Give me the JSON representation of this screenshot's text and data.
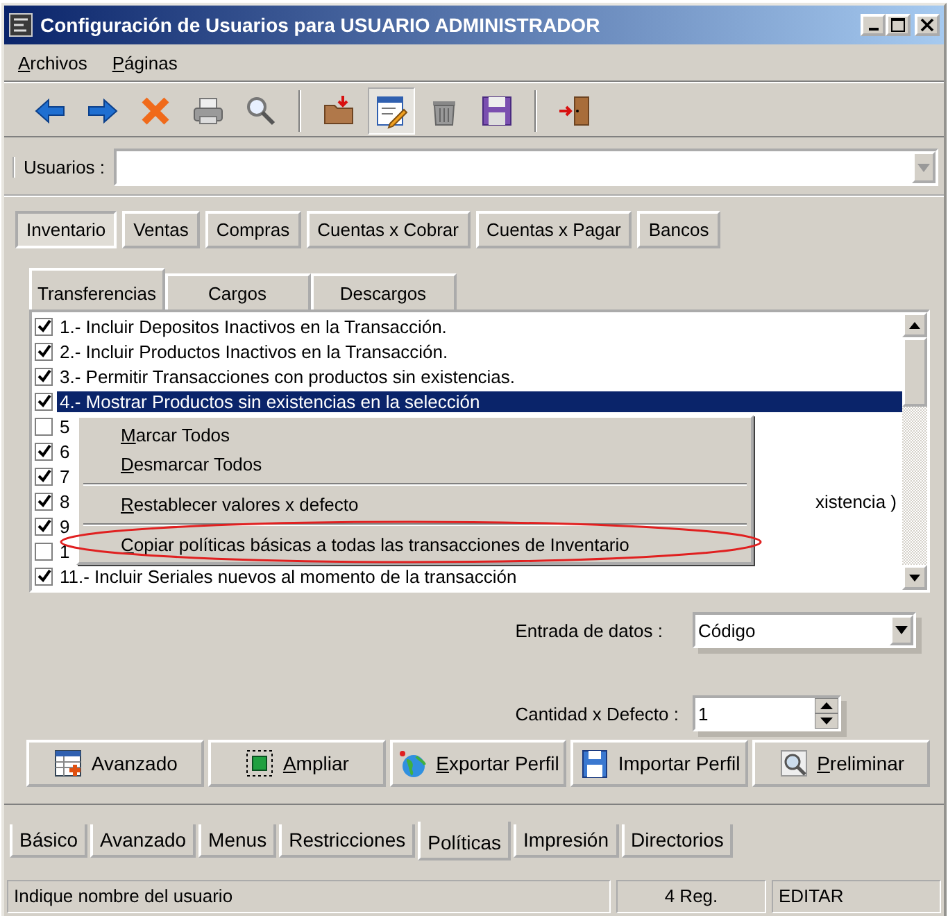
{
  "window": {
    "title": "Configuración de Usuarios para USUARIO ADMINISTRADOR"
  },
  "menu_bar": [
    {
      "label": "Archivos",
      "mnemonic": true
    },
    {
      "label": "Páginas",
      "mnemonic": true
    }
  ],
  "toolbar": [
    {
      "kind": "back",
      "pressed": false
    },
    {
      "kind": "forward",
      "pressed": false
    },
    {
      "kind": "delete",
      "pressed": false
    },
    {
      "kind": "print",
      "pressed": false
    },
    {
      "kind": "search",
      "pressed": false
    },
    {
      "kind": "separator"
    },
    {
      "kind": "open",
      "pressed": false
    },
    {
      "kind": "edit",
      "pressed": true
    },
    {
      "kind": "trash",
      "pressed": false
    },
    {
      "kind": "save",
      "pressed": false
    },
    {
      "kind": "separator"
    },
    {
      "kind": "exit",
      "pressed": false
    }
  ],
  "user_field": {
    "label": "Usuarios :"
  },
  "module_tabs": [
    {
      "label": "Inventario",
      "selected": true
    },
    {
      "label": "Ventas",
      "selected": false
    },
    {
      "label": "Compras",
      "selected": false
    },
    {
      "label": "Cuentas x Cobrar",
      "selected": false
    },
    {
      "label": "Cuentas x Pagar",
      "selected": false
    },
    {
      "label": "Bancos",
      "selected": false
    }
  ],
  "sub_tabs": [
    {
      "label": "Transferencias",
      "selected": true
    },
    {
      "label": "Cargos",
      "selected": false
    },
    {
      "label": "Descargos",
      "selected": false
    }
  ],
  "policies": [
    {
      "text": "1.- Incluir Depositos Inactivos en la Transacción.",
      "checked": true,
      "selected": false
    },
    {
      "text": "2.- Incluir Productos Inactivos en la Transacción.",
      "checked": true,
      "selected": false
    },
    {
      "text": "3.- Permitir Transacciones con productos sin existencias.",
      "checked": true,
      "selected": false
    },
    {
      "text": "4.- Mostrar Productos sin existencias en la selección",
      "checked": true,
      "selected": true
    },
    {
      "text": "5",
      "checked": false,
      "selected": false
    },
    {
      "text": "6",
      "checked": true,
      "selected": false
    },
    {
      "text": "7",
      "checked": true,
      "selected": false
    },
    {
      "text": "8",
      "text_end": "xistencia )",
      "checked": true,
      "selected": false
    },
    {
      "text": "9",
      "checked": true,
      "selected": false
    },
    {
      "text": "1",
      "checked": false,
      "selected": false
    },
    {
      "text": "11.- Incluir Seriales nuevos al momento de la transacción",
      "checked": true,
      "selected": false
    }
  ],
  "context_menu": [
    {
      "kind": "item",
      "label": "Marcar Todos",
      "mnemonic": true,
      "circled": false
    },
    {
      "kind": "item",
      "label": "Desmarcar Todos",
      "mnemonic": true,
      "circled": false
    },
    {
      "kind": "separator"
    },
    {
      "kind": "item",
      "label": "Restablecer valores x defecto",
      "mnemonic": true,
      "circled": false
    },
    {
      "kind": "separator"
    },
    {
      "kind": "item",
      "label": "Copiar políticas básicas a todas las transacciones de Inventario",
      "mnemonic": true,
      "circled": true
    }
  ],
  "data_entry": {
    "label": "Entrada de datos :",
    "value": "Código"
  },
  "default_quantity": {
    "label": "Cantidad x Defecto :",
    "value": "1"
  },
  "buttons": [
    {
      "label": "Avanzado",
      "kind": "grid",
      "mnemonic": false
    },
    {
      "label": "Ampliar",
      "kind": "expand",
      "mnemonic": true
    },
    {
      "label": "Exportar Perfil",
      "kind": "globe",
      "mnemonic": true
    },
    {
      "label": "Importar Perfil",
      "kind": "disk",
      "mnemonic": false
    },
    {
      "label": "Preliminar",
      "kind": "magnifier",
      "mnemonic": true
    }
  ],
  "page_tabs": [
    {
      "label": "Básico",
      "selected": false
    },
    {
      "label": "Avanzado",
      "selected": false
    },
    {
      "label": "Menus",
      "selected": false
    },
    {
      "label": "Restricciones",
      "selected": false
    },
    {
      "label": "Políticas",
      "selected": true
    },
    {
      "label": "Impresión",
      "selected": false
    },
    {
      "label": "Directorios",
      "selected": false
    }
  ],
  "status_bar": {
    "message": "Indique nombre del usuario",
    "count": "4 Reg.",
    "mode": "EDITAR"
  }
}
